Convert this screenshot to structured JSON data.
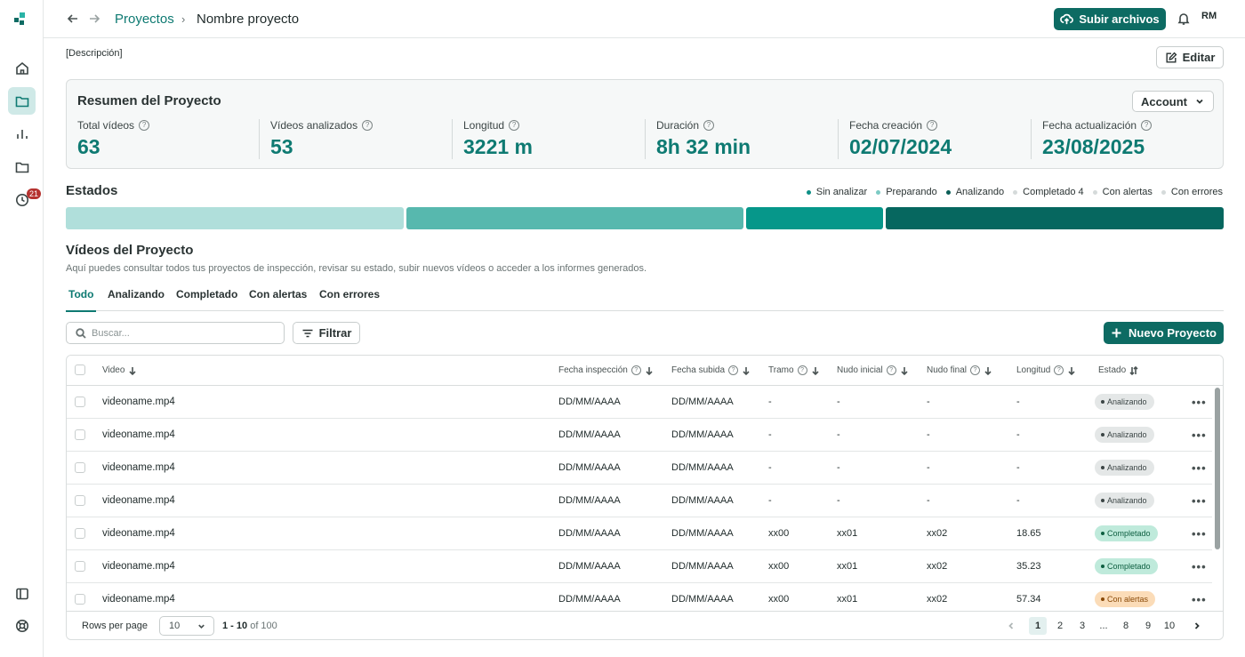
{
  "topbar": {
    "breadcrumb_parent": "Proyectos",
    "breadcrumb_current": "Nombre proyecto",
    "upload_label": "Subir archivos",
    "avatar_initials": "RM"
  },
  "sidebar": {
    "history_badge": "21"
  },
  "project": {
    "description": "[Descripción]",
    "edit_label": "Editar"
  },
  "summary": {
    "title": "Resumen del Proyecto",
    "account_label": "Account",
    "stats": [
      {
        "label": "Total vídeos",
        "value": "63"
      },
      {
        "label": "Vídeos analizados",
        "value": "53"
      },
      {
        "label": "Longitud",
        "value": "3221 m"
      },
      {
        "label": "Duración",
        "value": "8h 32 min"
      },
      {
        "label": "Fecha creación",
        "value": "02/07/2024"
      },
      {
        "label": "Fecha actualización",
        "value": "23/08/2025"
      }
    ]
  },
  "states": {
    "title": "Estados",
    "legend": [
      {
        "label": "Sin analizar",
        "color": "#0e8f86"
      },
      {
        "label": "Preparando",
        "color": "#7ccac4"
      },
      {
        "label": "Analizando",
        "color": "#0b5e57"
      },
      {
        "label": "Completado 4",
        "color": "#d5dada"
      },
      {
        "label": "Con alertas",
        "color": "#d5dada"
      },
      {
        "label": "Con errores",
        "color": "#d5dada"
      }
    ],
    "bar_colors": [
      "#b0dfdb",
      "#57b8ae",
      "#06978a",
      "#06675f"
    ]
  },
  "videos": {
    "title": "Vídeos del Proyecto",
    "subtitle": "Aquí puedes consultar todos tus proyectos de inspección, revisar su estado, subir nuevos vídeos o acceder a los informes generados.",
    "tabs": [
      "Todo",
      "Analizando",
      "Completado",
      "Con alertas",
      "Con errores"
    ],
    "search_placeholder": "Buscar...",
    "filter_label": "Filtrar",
    "new_label": "Nuevo Proyecto"
  },
  "table": {
    "headers": {
      "video": "Video",
      "fecha_inspeccion": "Fecha inspección",
      "fecha_subida": "Fecha subida",
      "tramo": "Tramo",
      "nudo_inicial": "Nudo inicial",
      "nudo_final": "Nudo final",
      "longitud": "Longitud",
      "estado": "Estado"
    },
    "rows": [
      {
        "video": "videoname.mp4",
        "fi": "DD/MM/AAAA",
        "fs": "DD/MM/AAAA",
        "tramo": "-",
        "ni": "-",
        "nf": "-",
        "long": "-",
        "estado": "Analizando",
        "kind": "analizando"
      },
      {
        "video": "videoname.mp4",
        "fi": "DD/MM/AAAA",
        "fs": "DD/MM/AAAA",
        "tramo": "-",
        "ni": "-",
        "nf": "-",
        "long": "-",
        "estado": "Analizando",
        "kind": "analizando"
      },
      {
        "video": "videoname.mp4",
        "fi": "DD/MM/AAAA",
        "fs": "DD/MM/AAAA",
        "tramo": "-",
        "ni": "-",
        "nf": "-",
        "long": "-",
        "estado": "Analizando",
        "kind": "analizando"
      },
      {
        "video": "videoname.mp4",
        "fi": "DD/MM/AAAA",
        "fs": "DD/MM/AAAA",
        "tramo": "-",
        "ni": "-",
        "nf": "-",
        "long": "-",
        "estado": "Analizando",
        "kind": "analizando"
      },
      {
        "video": "videoname.mp4",
        "fi": "DD/MM/AAAA",
        "fs": "DD/MM/AAAA",
        "tramo": "xx00",
        "ni": "xx01",
        "nf": "xx02",
        "long": "18.65",
        "estado": "Completado",
        "kind": "completado"
      },
      {
        "video": "videoname.mp4",
        "fi": "DD/MM/AAAA",
        "fs": "DD/MM/AAAA",
        "tramo": "xx00",
        "ni": "xx01",
        "nf": "xx02",
        "long": "35.23",
        "estado": "Completado",
        "kind": "completado"
      },
      {
        "video": "videoname.mp4",
        "fi": "DD/MM/AAAA",
        "fs": "DD/MM/AAAA",
        "tramo": "xx00",
        "ni": "xx01",
        "nf": "xx02",
        "long": "57.34",
        "estado": "Con alertas",
        "kind": "alertas"
      }
    ],
    "status_styles": {
      "analizando": {
        "bg": "#e4e7e7",
        "fg": "#3b4545",
        "dot": "#3b4545"
      },
      "completado": {
        "bg": "#bfeadb",
        "fg": "#0d5e40",
        "dot": "#0d5e40"
      },
      "alertas": {
        "bg": "#fbdcb8",
        "fg": "#8a4a08",
        "dot": "#8a4a08"
      }
    }
  },
  "pagination": {
    "rows_per_page_label": "Rows per page",
    "rows_per_page_value": "10",
    "range": "1 - 10",
    "range_of": "of 100",
    "pages": [
      "1",
      "2",
      "3",
      "...",
      "8",
      "9",
      "10"
    ],
    "current_page": "1"
  }
}
